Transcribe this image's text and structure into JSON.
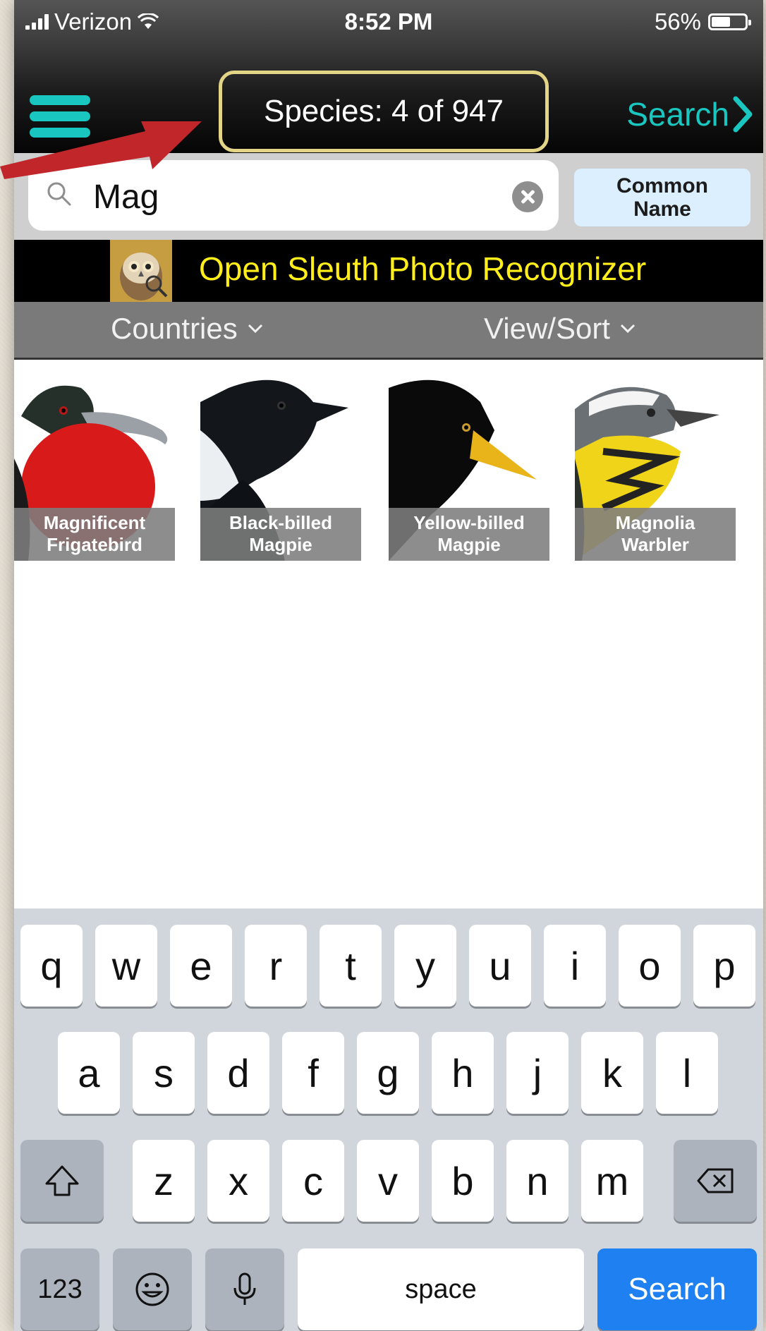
{
  "status_bar": {
    "carrier": "Verizon",
    "time": "8:52 PM",
    "battery_percent": "56%",
    "battery_level": 0.56
  },
  "nav": {
    "menu_icon": "hamburger-menu-icon",
    "species_count": "Species: 4 of 947",
    "search_label": "Search",
    "accent_color": "#19c7c0"
  },
  "search": {
    "value": "Mag",
    "mode_label_line1": "Common",
    "mode_label_line2": "Name"
  },
  "sleuth_banner": {
    "label": "Open Sleuth Photo Recognizer",
    "text_color": "#ffee1a"
  },
  "filters": {
    "countries_label": "Countries",
    "view_sort_label": "View/Sort"
  },
  "birds": [
    {
      "line1": "Magnificent",
      "line2": "Frigatebird"
    },
    {
      "line1": "Black-billed",
      "line2": "Magpie"
    },
    {
      "line1": "Yellow-billed",
      "line2": "Magpie"
    },
    {
      "line1": "Magnolia",
      "line2": "Warbler"
    }
  ],
  "keyboard": {
    "row1": [
      "q",
      "w",
      "e",
      "r",
      "t",
      "y",
      "u",
      "i",
      "o",
      "p"
    ],
    "row2": [
      "a",
      "s",
      "d",
      "f",
      "g",
      "h",
      "j",
      "k",
      "l"
    ],
    "row3": [
      "z",
      "x",
      "c",
      "v",
      "b",
      "n",
      "m"
    ],
    "numbers_label": "123",
    "space_label": "space",
    "search_label": "Search",
    "search_key_color": "#1f80f1"
  }
}
